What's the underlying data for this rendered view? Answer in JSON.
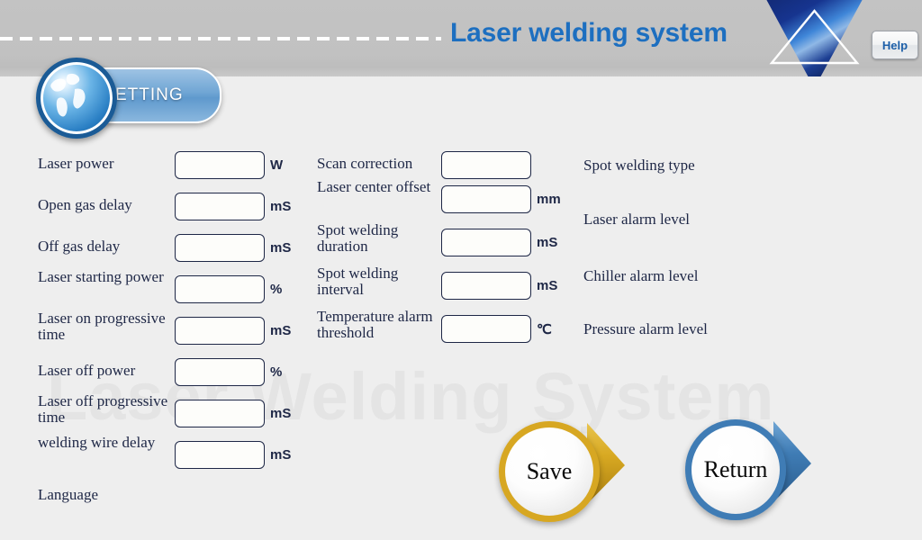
{
  "header": {
    "title": "Laser welding system",
    "help_label": "Help",
    "logo_icon": "triangle-logo",
    "dash_divider": "dashed-rule"
  },
  "setting_badge": {
    "label": "SETTING",
    "icon": "globe-icon"
  },
  "watermark": "Laser Welding System",
  "form": {
    "left_column": [
      {
        "label": "Laser power",
        "value": "",
        "unit": "W"
      },
      {
        "label": "Open gas delay",
        "value": "",
        "unit": "mS"
      },
      {
        "label": "Off gas delay",
        "value": "",
        "unit": "mS"
      },
      {
        "label": "Laser starting power",
        "value": "",
        "unit": "%"
      },
      {
        "label": "Laser on progressive time",
        "value": "",
        "unit": "mS"
      },
      {
        "label": "Laser off power",
        "value": "",
        "unit": "%"
      },
      {
        "label": "Laser off progressive time",
        "value": "",
        "unit": "mS"
      },
      {
        "label": "welding wire delay",
        "value": "",
        "unit": "mS"
      },
      {
        "label": "Language",
        "value": null,
        "unit": ""
      }
    ],
    "mid_column": [
      {
        "label": "Scan correction",
        "value": "",
        "unit": ""
      },
      {
        "label": "Laser center offset",
        "value": "",
        "unit": "mm"
      },
      {
        "label": "Spot welding duration",
        "value": "",
        "unit": "mS"
      },
      {
        "label": "Spot welding interval",
        "value": "",
        "unit": "mS"
      },
      {
        "label": "Temperature alarm threshold",
        "value": "",
        "unit": "℃"
      }
    ],
    "right_column": [
      {
        "label": "Spot welding type"
      },
      {
        "label": "Laser alarm level"
      },
      {
        "label": "Chiller alarm level"
      },
      {
        "label": "Pressure alarm level"
      }
    ]
  },
  "actions": {
    "save_label": "Save",
    "return_label": "Return"
  },
  "colors": {
    "title_blue": "#1d6fc0",
    "label_navy": "#1e2746",
    "save_gold": "#d7a722",
    "return_blue": "#3f7cb5",
    "header_gray": "#c1c1c1",
    "body_gray": "#eeeeee"
  }
}
